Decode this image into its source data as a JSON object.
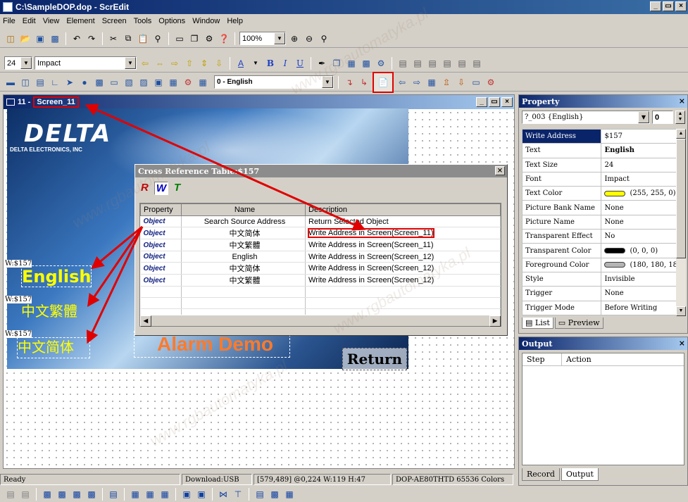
{
  "app": {
    "title": "C:\\SampleDOP.dop - ScrEdit",
    "min": "_",
    "max": "&",
    "close": "×"
  },
  "menu": [
    "File",
    "Edit",
    "View",
    "Element",
    "Screen",
    "Tools",
    "Options",
    "Window",
    "Help"
  ],
  "toolbar1": {
    "zoom": "100%"
  },
  "toolbar2": {
    "font_size": "24",
    "font_name": "Impact"
  },
  "toolbar3": {
    "language": "0 - English"
  },
  "screen_window": {
    "title_num": "11 - ",
    "title_name": "Screen_11"
  },
  "canvas": {
    "logo_text": "DELTA",
    "logo_sub": "DELTA ELECTRONICS, INC",
    "labels": [
      {
        "tag": "W:$157",
        "text": "English"
      },
      {
        "tag": "W:$157",
        "text": "中文繁體"
      },
      {
        "tag": "W:$157",
        "text": "中文简体"
      }
    ],
    "alarm_text": "Alarm Demo",
    "return_text": "Return"
  },
  "xref": {
    "title": "Cross Reference Table:$157",
    "tabs": [
      "R",
      "W",
      "T"
    ],
    "columns": [
      "Property",
      "Name",
      "Description"
    ],
    "rows": [
      {
        "property": "Object",
        "name": "Search Source Address",
        "description": "Return Selected Object"
      },
      {
        "property": "Object",
        "name": "中文简体",
        "description": "Write Address in Screen(Screen_11)"
      },
      {
        "property": "Object",
        "name": "中文繁體",
        "description": "Write Address in Screen(Screen_11)"
      },
      {
        "property": "Object",
        "name": "English",
        "description": "Write Address in Screen(Screen_12)"
      },
      {
        "property": "Object",
        "name": "中文简体",
        "description": "Write Address in Screen(Screen_12)"
      },
      {
        "property": "Object",
        "name": "中文繁體",
        "description": "Write Address in Screen(Screen_12)"
      }
    ]
  },
  "property_panel": {
    "title": "Property",
    "selector": "?_003 {English}",
    "selector_num": "0",
    "rows": [
      {
        "key": "Write Address",
        "value": "$157"
      },
      {
        "key": "Text",
        "value": "English"
      },
      {
        "key": "Text Size",
        "value": "24"
      },
      {
        "key": "Font",
        "value": "Impact"
      },
      {
        "key": "Text Color",
        "value": "(255, 255, 0)",
        "swatch": "#ffff00"
      },
      {
        "key": "Picture Bank Name",
        "value": "None"
      },
      {
        "key": "Picture Name",
        "value": "None"
      },
      {
        "key": "Transparent Effect",
        "value": "No"
      },
      {
        "key": "Transparent Color",
        "value": "(0, 0, 0)",
        "swatch": "#000000"
      },
      {
        "key": "Foreground Color",
        "value": "(180, 180, 18",
        "swatch": "#b4b4b4"
      },
      {
        "key": "Style",
        "value": "Invisible"
      },
      {
        "key": "Trigger",
        "value": "None"
      },
      {
        "key": "Trigger Mode",
        "value": "Before Writing"
      }
    ],
    "tab_list": "List",
    "tab_preview": "Preview"
  },
  "output_panel": {
    "title": "Output",
    "columns": [
      "Step",
      "Action"
    ],
    "tab_record": "Record",
    "tab_output": "Output"
  },
  "status": {
    "ready": "Ready",
    "download": "Download:USB",
    "coords": "[579,489] @0,224 W:119 H:47",
    "model": "DOP-AE80THTD 65536 Colors"
  },
  "watermark": "www.rgbautomatyka.pl",
  "colors": {
    "highlight": "#e00000",
    "title_blue": "#0a246a",
    "label_yellow": "#ffff00"
  }
}
